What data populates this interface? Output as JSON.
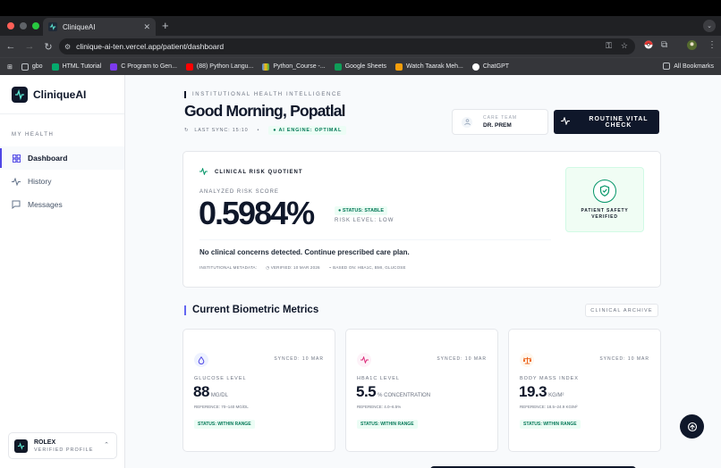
{
  "browser": {
    "tab_title": "CliniqueAI",
    "url": "clinique-ai-ten.vercel.app/patient/dashboard",
    "bookmarks": [
      "gbo",
      "HTML Tutorial",
      "C Program to Gen...",
      "(88) Python Langu...",
      "Python_Course -...",
      "Google Sheets",
      "Watch Taarak Meh...",
      "ChatGPT"
    ],
    "all_bookmarks": "All Bookmarks"
  },
  "sidebar": {
    "brand": "CliniqueAI",
    "heading": "MY HEALTH",
    "items": [
      {
        "label": "Dashboard",
        "icon": "grid-icon"
      },
      {
        "label": "History",
        "icon": "activity-icon"
      },
      {
        "label": "Messages",
        "icon": "message-icon"
      }
    ],
    "profile": {
      "name": "ROLEX",
      "subtitle": "VERIFIED PROFILE"
    }
  },
  "header": {
    "eyebrow": "INSTITUTIONAL HEALTH INTELLIGENCE",
    "greeting": "Good Morning, Popatlal",
    "last_sync": "LAST SYNC: 15:10",
    "separator": "•",
    "engine": "● AI ENGINE: OPTIMAL",
    "care_team_label": "CARE TEAM",
    "care_team_name": "DR. PREM",
    "routine_button": "ROUTINE VITAL CHECK"
  },
  "risk": {
    "title": "CLINICAL RISK QUOTIENT",
    "score_label": "ANALYZED RISK SCORE",
    "score": "0.5984%",
    "status": "● STATUS: STABLE",
    "level": "RISK LEVEL: LOW",
    "message": "No clinical concerns detected. Continue prescribed care plan.",
    "meta_label": "INSTITUTIONAL METADATA:",
    "verified": "VERIFIED: 10 MAR 2026",
    "based_on": "BASED ON: HBA1C, BMI, GLUCOSE",
    "safety": "PATIENT SAFETY VERIFIED"
  },
  "metrics": {
    "section_title": "Current Biometric Metrics",
    "archive_button": "CLINICAL ARCHIVE",
    "cards": [
      {
        "label": "GLUCOSE LEVEL",
        "value": "88",
        "unit": "MG/DL",
        "synced": "SYNCED: 10 MAR",
        "reference": "REFERENCE: 70–140 MG/DL",
        "status": "STATUS: WITHIN RANGE",
        "icon": "droplet-icon",
        "color": "#4f46e5",
        "bg": "#eef2ff"
      },
      {
        "label": "HBA1C LEVEL",
        "value": "5.5",
        "unit": "% CONCENTRATION",
        "synced": "SYNCED: 10 MAR",
        "reference": "REFERENCE: 4.0–6.5%",
        "status": "STATUS: WITHIN RANGE",
        "icon": "activity-icon",
        "color": "#db2777",
        "bg": "#fdf2f8"
      },
      {
        "label": "BODY MASS INDEX",
        "value": "19.3",
        "unit": "KG/M²",
        "synced": "SYNCED: 10 MAR",
        "reference": "REFERENCE: 18.5–24.9 KG/M²",
        "status": "STATUS: WITHIN RANGE",
        "icon": "scale-icon",
        "color": "#ea580c",
        "bg": "#fff7ed"
      }
    ]
  },
  "colors": {
    "accent": "#4f46e5",
    "dark": "#0f172a",
    "success": "#047857"
  }
}
